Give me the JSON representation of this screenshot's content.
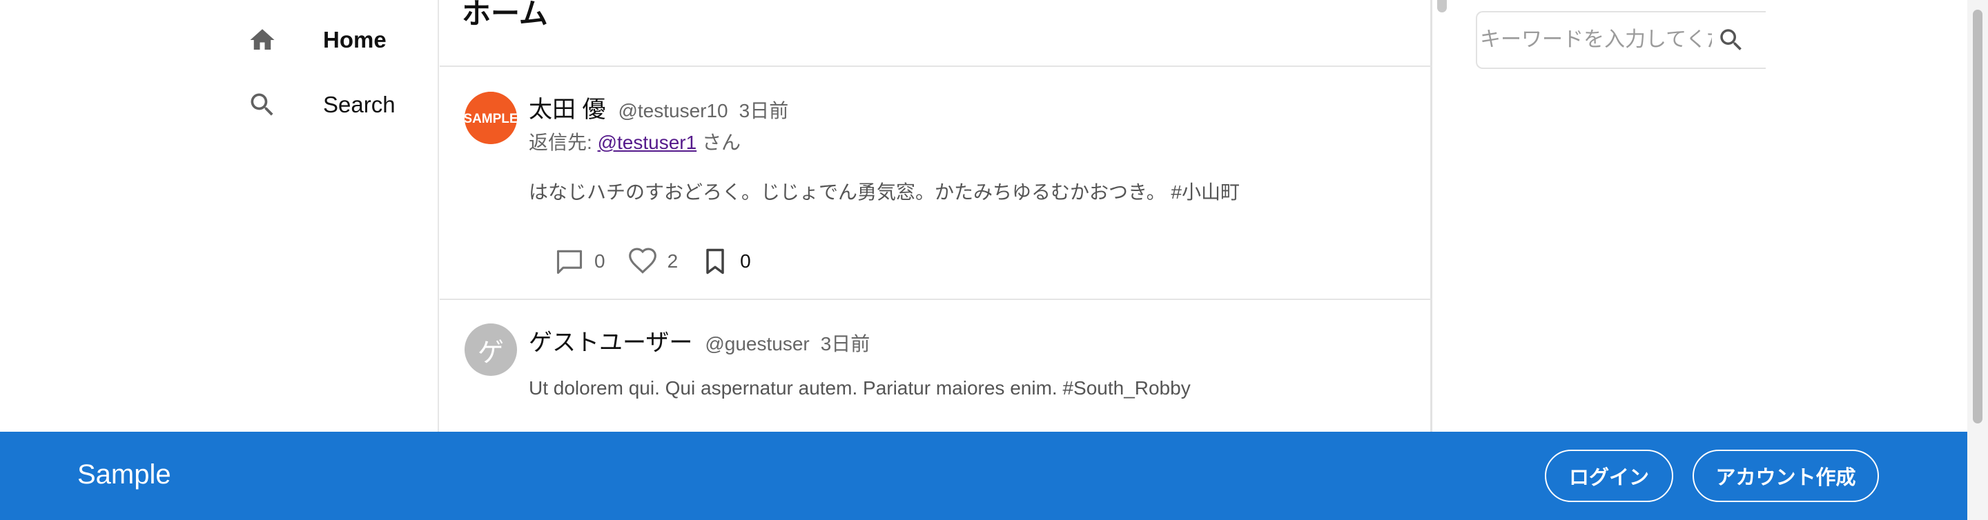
{
  "nav": {
    "items": [
      {
        "label": "Home",
        "icon": "home-icon"
      },
      {
        "label": "Search",
        "icon": "search-icon"
      }
    ]
  },
  "main": {
    "title": "ホーム",
    "posts": [
      {
        "author": "太田 優",
        "handle": "@testuser10",
        "time": "3日前",
        "reply_prefix": "返信先: ",
        "reply_to": "@testuser1",
        "reply_suffix": " さん",
        "avatar_text": "SAMPLE",
        "body": "はなじハチのすおどろく。じじょでん勇気窓。かたみちゆるむかおつき。 #小山町",
        "comments": "0",
        "likes": "2",
        "bookmarks": "0"
      },
      {
        "author": "ゲストユーザー",
        "handle": "@guestuser",
        "time": "3日前",
        "avatar_text": "ゲ",
        "body": "Ut dolorem qui. Qui aspernatur autem. Pariatur maiores enim. #South_Robby"
      }
    ]
  },
  "search": {
    "placeholder": "キーワードを入力してください"
  },
  "banner": {
    "brand": "Sample",
    "login_label": "ログイン",
    "signup_label": "アカウント作成"
  },
  "colors": {
    "banner": "#1976d2",
    "sample_avatar": "#f15a22",
    "guest_avatar": "#bdbdbd",
    "link": "#551a8b"
  }
}
